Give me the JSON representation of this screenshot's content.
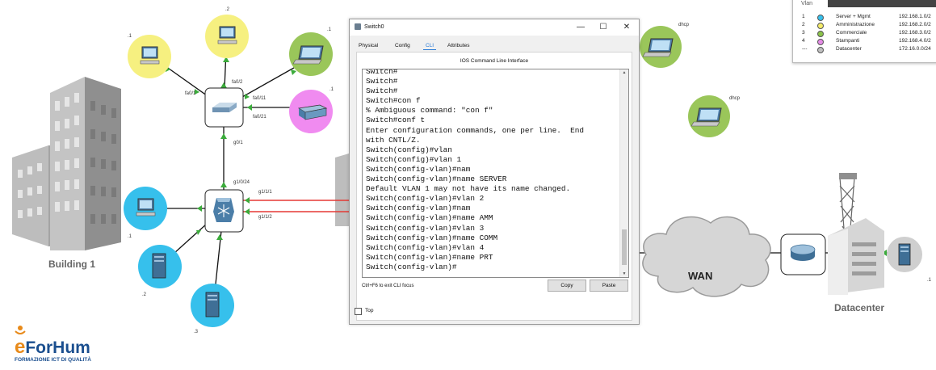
{
  "topology": {
    "building1_label": "Building 1",
    "datacenter_label": "Datacenter",
    "wan_label": "WAN",
    "pc_top_label": ".2",
    "pc_left_label": ".1",
    "laptop_right_label": ".1",
    "printer_label": ".1",
    "pc_mid_label": ".1",
    "server_left_label": ".2",
    "server_bottom_label": ".3",
    "server_dc_label": ".1",
    "laptop_dhcp1_label": "dhcp",
    "laptop_dhcp2_label": "dhcp",
    "port_fa01": "fa0/1",
    "port_fa02": "fa0/2",
    "port_fa011": "fa0/11",
    "port_fa021": "fa0/21",
    "port_g01": "g0/1",
    "port_g1024": "g1/0/24",
    "port_g111": "g1/1/1",
    "port_g112": "g1/1/2"
  },
  "legend": {
    "header": "Vlan",
    "rows": [
      {
        "id": "1",
        "name": "Server + Mgmt",
        "subnet": "192.168.1.0/2",
        "color": "#36c0ec"
      },
      {
        "id": "2",
        "name": "Amministrazione",
        "subnet": "192.168.2.0/2",
        "color": "#f5ec6a"
      },
      {
        "id": "3",
        "name": "Commerciale",
        "subnet": "192.168.3.0/2",
        "color": "#8bc34a"
      },
      {
        "id": "4",
        "name": "Stampanti",
        "subnet": "192.168.4.0/2",
        "color": "#e58be6"
      },
      {
        "id": "---",
        "name": "Datacenter",
        "subnet": "172.16.0.0/24",
        "color": "#bfbfbf"
      }
    ]
  },
  "window": {
    "title": "Switch0",
    "min": "—",
    "max": "☐",
    "close": "✕",
    "tabs": [
      "Physical",
      "Config",
      "CLI",
      "Attributes"
    ],
    "active_tab": "CLI",
    "cli_title": "IOS Command Line Interface",
    "console_text": "Switch#\nSwitch#\nSwitch#\nSwitch#con f\n% Ambiguous command: \"con f\"\nSwitch#conf t\nEnter configuration commands, one per line.  End\nwith CNTL/Z.\nSwitch(config)#vlan\nSwitch(config)#vlan 1\nSwitch(config-vlan)#nam\nSwitch(config-vlan)#name SERVER\nDefault VLAN 1 may not have its name changed.\nSwitch(config-vlan)#vlan 2\nSwitch(config-vlan)#nam\nSwitch(config-vlan)#name AMM\nSwitch(config-vlan)#vlan 3\nSwitch(config-vlan)#name COMM\nSwitch(config-vlan)#vlan 4\nSwitch(config-vlan)#name PRT\nSwitch(config-vlan)#",
    "hint": "Ctrl+F6 to exit CLI focus",
    "copy": "Copy",
    "paste": "Paste",
    "top_checkbox": "Top"
  },
  "logo": {
    "brand_prefix": "e",
    "brand_rest": "ForHum",
    "tagline": "FORMAZIONE ICT DI QUALITÀ"
  }
}
